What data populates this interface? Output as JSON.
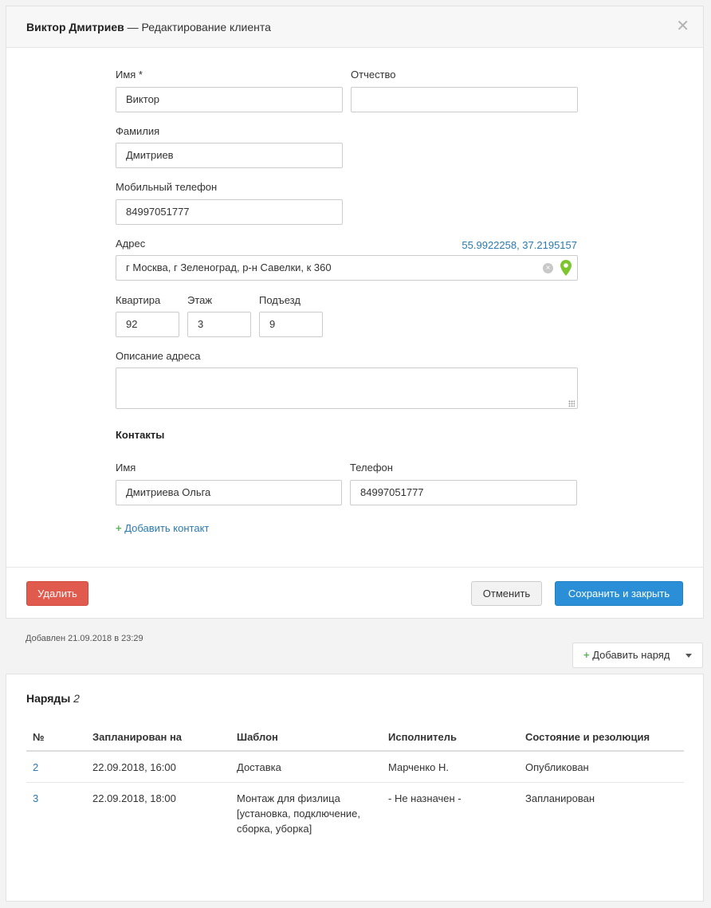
{
  "header": {
    "client_name": "Виктор Дмитриев",
    "subtitle": "— Редактирование клиента"
  },
  "form": {
    "first_name_label": "Имя *",
    "first_name_value": "Виктор",
    "patronymic_label": "Отчество",
    "patronymic_value": "",
    "last_name_label": "Фамилия",
    "last_name_value": "Дмитриев",
    "mobile_label": "Мобильный телефон",
    "mobile_value": "84997051777",
    "address_label": "Адрес",
    "address_coords": "55.9922258, 37.2195157",
    "address_value": "г Москва, г Зеленоград, р-н Савелки, к 360",
    "apartment_label": "Квартира",
    "apartment_value": "92",
    "floor_label": "Этаж",
    "floor_value": "3",
    "entrance_label": "Подъезд",
    "entrance_value": "9",
    "address_desc_label": "Описание адреса",
    "address_desc_value": ""
  },
  "contacts": {
    "title": "Контакты",
    "name_label": "Имя",
    "phone_label": "Телефон",
    "items": [
      {
        "name": "Дмитриева Ольга",
        "phone": "84997051777"
      }
    ],
    "add_label": "Добавить контакт"
  },
  "footer": {
    "delete_label": "Удалить",
    "cancel_label": "Отменить",
    "save_label": "Сохранить и закрыть"
  },
  "meta": {
    "added_at": "Добавлен 21.09.2018 в 23:29",
    "add_order_label": "Добавить наряд"
  },
  "orders": {
    "title": "Наряды",
    "count": "2",
    "columns": [
      "№",
      "Запланирован на",
      "Шаблон",
      "Исполнитель",
      "Состояние и резолюция"
    ],
    "rows": [
      {
        "num": "2",
        "planned": "22.09.2018, 16:00",
        "template": "Доставка",
        "executor": "Марченко Н.",
        "status": "Опубликован"
      },
      {
        "num": "3",
        "planned": "22.09.2018, 18:00",
        "template": "Монтаж для физлица [установка, подключение, сборка, уборка]",
        "executor": "- Не назначен -",
        "status": "Запланирован"
      }
    ]
  },
  "colors": {
    "danger": "#e05a4e",
    "primary": "#2a8fd6",
    "link": "#2a7ab0",
    "pin": "#7cc52c"
  },
  "icons": [
    "close-icon",
    "clear-icon",
    "map-pin-icon",
    "plus-icon",
    "caret-down-icon"
  ]
}
